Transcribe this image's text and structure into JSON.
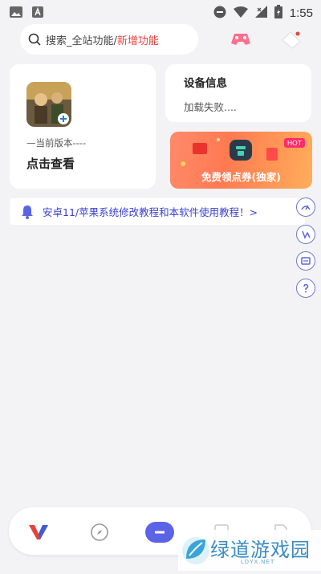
{
  "status_bar": {
    "time": "1:55"
  },
  "search": {
    "placeholder": "搜索_全站功能/",
    "highlight": "新增功能"
  },
  "game_card": {
    "version_label": "—当前版本----",
    "check_label": "点击查看"
  },
  "device_card": {
    "title": "设备信息",
    "status": "加载失败...."
  },
  "coupon_banner": {
    "text": "免费领点券(独家)",
    "badge": "HOT"
  },
  "notice": {
    "text": "安卓11/苹果系统修改教程和本软件使用教程！>"
  },
  "watermark": {
    "text": "绿道游戏园",
    "sub": "LDYX.NET"
  },
  "colors": {
    "accent": "#5b63e6",
    "highlight": "#e8423a",
    "notice_text": "#3a3fd0"
  }
}
